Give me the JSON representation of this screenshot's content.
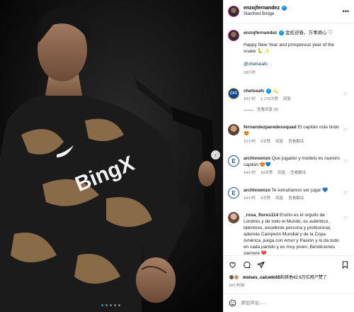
{
  "post": {
    "photo_alt_icon": "post-photo",
    "carousel": {
      "count": 5,
      "active": 0
    },
    "next_icon": "chevron-right-icon"
  },
  "header": {
    "username": "enzojfernandez",
    "location": "Stamford Bridge",
    "more_icon": "more-horizontal-icon"
  },
  "caption": {
    "username": "enzojfernandez",
    "inline": "金蛇迎春，万事顺心 ♡",
    "text": "Happy New Year and prosperous year of the snake 🐍 ✨",
    "mention": "@chelseafc",
    "time": "18小时"
  },
  "comments": [
    {
      "user": "chelseafc",
      "text": "💫",
      "time": "18小时",
      "likes": "1,176次赞",
      "reply": "回复",
      "view_replies": "查看回复 (5)"
    },
    {
      "user": "fernandezparedessquad",
      "text": "El capitán más lindo 😍",
      "time": "15小时",
      "likes": "6次赞",
      "reply": "回复",
      "view_replies": "查看翻译"
    },
    {
      "user": "archivoenzo",
      "text": "Que jugador y modelo es nuestro capitán 😍💙",
      "time": "14小时",
      "likes": "10次赞",
      "reply": "回复",
      "view_replies": "查看翻译"
    },
    {
      "user": "archivoenzo",
      "text": "Te extrañamos ver jugar 💙",
      "time": "14小时",
      "likes": "6次赞",
      "reply": "回复",
      "view_replies": "查看翻译"
    },
    {
      "user": "_rosa_flores114",
      "text": "Enzito es el orgullo de Londres y de todo el Mundo, es auténtico, talentoso, excelente persona y profesional, además Campeón Mundial y de la Copa América, juega con Amor y Pasión y lo da todo en cada partido y es muy joven ,Bendiciones siempre ❤️",
      "time": "",
      "likes": "",
      "reply": "",
      "view_replies": ""
    }
  ],
  "likes_line": {
    "user": "moises_caicedo55",
    "rest": "和其他42.6万位用户赞了"
  },
  "post_time": "18小时前",
  "comment_box": {
    "placeholder": "添加评论......"
  },
  "icons": [
    "heart-icon",
    "comment-icon",
    "share-icon",
    "bookmark-icon",
    "emoji-icon"
  ],
  "colors": {
    "accent": "#0095f6",
    "chelsea": "#034694",
    "reply_heart": "#ed4956"
  }
}
